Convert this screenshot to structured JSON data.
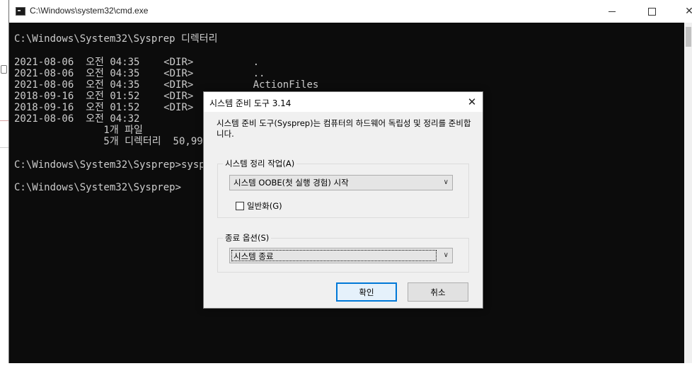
{
  "cmd": {
    "title": "C:\\Windows\\system32\\cmd.exe",
    "controls": {
      "minimize": "",
      "maximize": "",
      "close": "✕"
    },
    "lines": [
      "C:\\Windows\\System32\\Sysprep 디렉터리",
      "2021-08-06  오전 04:35    <DIR>          .",
      "2021-08-06  오전 04:35    <DIR>          ..",
      "2021-08-06  오전 04:35    <DIR>          ActionFiles",
      "2018-09-16  오전 01:52    <DIR>",
      "2018-09-16  오전 01:52    <DIR>",
      "2021-08-06  오전 04:32           1,35",
      "               1개 파일",
      "               5개 디렉터리  50,999",
      "C:\\Windows\\System32\\Sysprep>syspre",
      "C:\\Windows\\System32\\Sysprep>"
    ]
  },
  "dialog": {
    "title": "시스템 준비 도구 3.14",
    "close": "✕",
    "description": "시스템 준비 도구(Sysprep)는 컴퓨터의 하드웨어 독립성 및 정리를 준비합니다.",
    "cleanup_group": {
      "label": "시스템 정리 작업(A)",
      "selected": "시스템 OOBE(첫 실행 경험) 시작",
      "generalize_label": "일반화(G)",
      "generalize_checked": false
    },
    "shutdown_group": {
      "label": "종료 옵션(S)",
      "selected": "시스템 종료"
    },
    "ok_label": "확인",
    "cancel_label": "취소"
  },
  "colors": {
    "console_bg": "#0c0c0c",
    "console_text": "#cccccc",
    "dialog_bg": "#f0f0f0",
    "accent": "#0078d7"
  }
}
